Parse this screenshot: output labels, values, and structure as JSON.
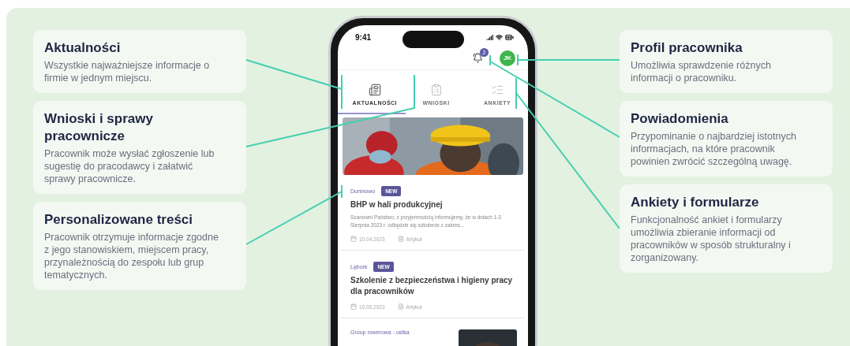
{
  "callouts_left": [
    {
      "title": "Aktualności",
      "text": "Wszystkie najważniejsze informacje o firmie w jednym miejscu."
    },
    {
      "title": "Wnioski i sprawy pracownicze",
      "text": "Pracownik może wysłać zgłoszenie lub sugestię do pracodawcy i załatwić sprawy pracownicze."
    },
    {
      "title": "Personalizowane treści",
      "text": "Pracownik otrzymuje informacje zgodne z jego stanowiskiem, miejscem pracy, przynależnością do zespołu lub grup tematycznych."
    }
  ],
  "phone": {
    "status_bar": {
      "time": "9:41"
    },
    "notifications": {
      "count": "2"
    },
    "avatar": {
      "initials": "JK"
    },
    "tabs": [
      {
        "label": "AKTUALNOŚCI",
        "selected": true
      },
      {
        "label": "WNIOSKI",
        "selected": false
      },
      {
        "label": "ANKIETY",
        "selected": false
      }
    ],
    "news": [
      {
        "location": "Duninowo",
        "badge": "NEW",
        "title": "BHP w hali produkcyjnej",
        "excerpt": "Szanowni Państwo, z przyjemnością informujemy, że w dniach 1-3 Sierpnia 2023 r. odbędzie się szkolenie z zakres...",
        "date": "10.04.2023",
        "type": "Artykuł"
      },
      {
        "location": "Lębork",
        "badge": "NEW",
        "title": "Szkolenie z bezpieczeństwa i higieny pracy dla pracowników",
        "date": "10.05.2023",
        "type": "Artykuł"
      },
      {
        "location": "Group rowerowa - ustka"
      }
    ]
  },
  "callouts_right": [
    {
      "title": "Profil pracownika",
      "text": "Umożliwia sprawdzenie różnych informacji o pracowniku."
    },
    {
      "title": "Powiadomienia",
      "text": "Przypominanie o najbardziej istotnych informacjach, na które pracownik powinien zwrócić szczególną uwagę."
    },
    {
      "title": "Ankiety i formularze",
      "text": "Funkcjonalność ankiet i formularzy umożliwia zbieranie informacji od pracowników w sposób strukturalny i zorganizowany."
    }
  ]
}
